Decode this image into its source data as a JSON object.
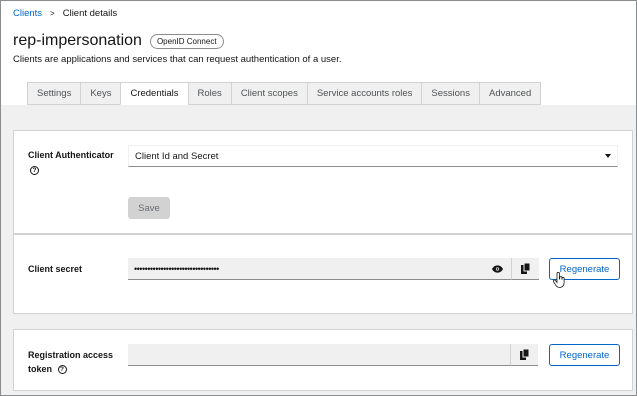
{
  "breadcrumb": {
    "parent": "Clients",
    "current": "Client details"
  },
  "header": {
    "title": "rep-impersonation",
    "badge": "OpenID Connect",
    "subtitle": "Clients are applications and services that can request authentication of a user."
  },
  "tabs": [
    {
      "label": "Settings",
      "active": false
    },
    {
      "label": "Keys",
      "active": false
    },
    {
      "label": "Credentials",
      "active": true
    },
    {
      "label": "Roles",
      "active": false
    },
    {
      "label": "Client scopes",
      "active": false
    },
    {
      "label": "Service accounts roles",
      "active": false
    },
    {
      "label": "Sessions",
      "active": false
    },
    {
      "label": "Advanced",
      "active": false
    }
  ],
  "authenticator": {
    "label": "Client Authenticator",
    "selected": "Client Id and Secret",
    "save_label": "Save"
  },
  "secret": {
    "label": "Client secret",
    "value": "••••••••••••••••••••••••••••••••",
    "regenerate_label": "Regenerate"
  },
  "token": {
    "label_line1": "Registration access",
    "label_line2": "token",
    "value": "",
    "regenerate_label": "Regenerate"
  },
  "colors": {
    "link": "#0066cc",
    "border": "#d2d2d2",
    "background": "#f0f0f0"
  }
}
